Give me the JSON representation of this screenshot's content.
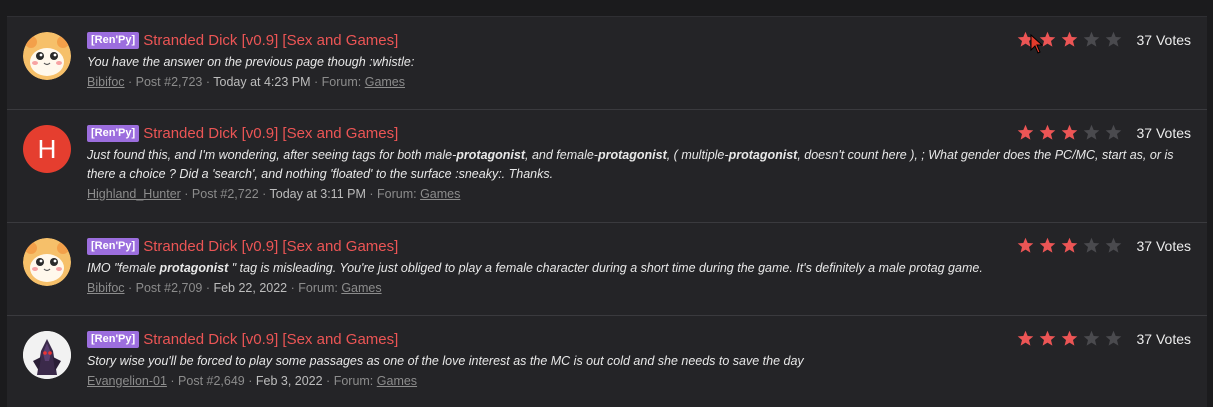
{
  "colors": {
    "accent": "#ec5555",
    "tag": "#9c6ede",
    "star_on": "#ec5555",
    "star_off": "#4a4a4e"
  },
  "results": [
    {
      "tag": "[Ren'Py]",
      "title": "Stranded Dick [v0.9] [Sex and Games]",
      "snippet": "You have the answer on the previous page though :whistle:",
      "author": "Bibifoc",
      "post": "Post #2,723",
      "time": "Today at 4:23 PM",
      "forum_label": "Forum:",
      "forum": "Games",
      "rating": 3,
      "votes": "37 Votes",
      "avatar": "hamster-avatar"
    },
    {
      "tag": "[Ren'Py]",
      "title": "Stranded Dick [v0.9] [Sex and Games]",
      "snippet_parts": [
        "Just found this, and I'm wondering, after seeing tags for both male-",
        "protagonist",
        ", and female-",
        "protagonist",
        ", ( multiple-",
        "protagonist",
        ", doesn't count here ), ; What gender does the PC/MC, start as, or is there a choice ? Did a 'search', and nothing 'floated' to the surface :sneaky:. Thanks."
      ],
      "author": "Highland_Hunter",
      "post": "Post #2,722",
      "time": "Today at 3:11 PM",
      "forum_label": "Forum:",
      "forum": "Games",
      "rating": 3,
      "votes": "37 Votes",
      "avatar_letter": "H"
    },
    {
      "tag": "[Ren'Py]",
      "title": "Stranded Dick [v0.9] [Sex and Games]",
      "snippet_parts": [
        "IMO \"female ",
        "protagonist",
        " \" tag is misleading. You're just obliged to play a female character during a short time during the game. It's definitely a male protag game."
      ],
      "author": "Bibifoc",
      "post": "Post #2,709",
      "time": "Feb 22, 2022",
      "forum_label": "Forum:",
      "forum": "Games",
      "rating": 3,
      "votes": "37 Votes",
      "avatar": "hamster-avatar"
    },
    {
      "tag": "[Ren'Py]",
      "title": "Stranded Dick [v0.9] [Sex and Games]",
      "snippet": "Story wise you'll be forced to play some passages as one of the love interest as the MC is out cold and she needs to save the day",
      "author": "Evangelion-01",
      "post": "Post #2,649",
      "time": "Feb 3, 2022",
      "forum_label": "Forum:",
      "forum": "Games",
      "rating": 3,
      "votes": "37 Votes",
      "avatar": "mecha-avatar"
    }
  ]
}
